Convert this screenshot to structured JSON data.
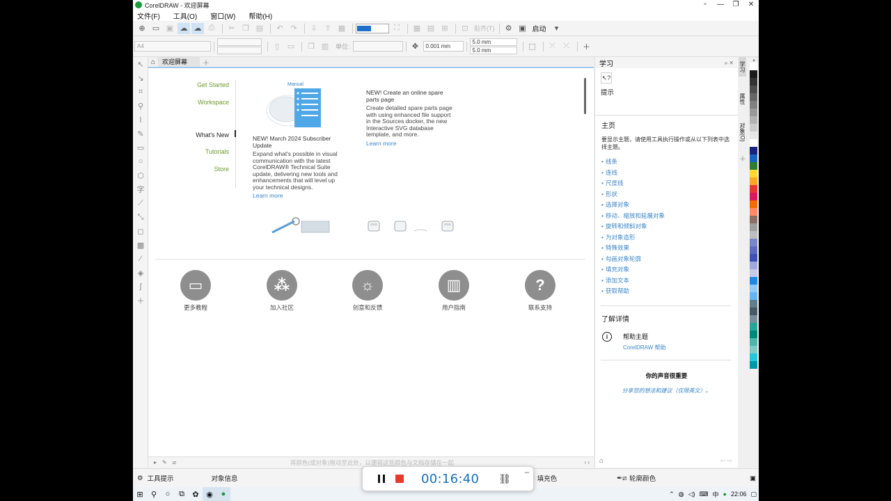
{
  "window": {
    "title": "CorelDRAW - 欢迎屏幕",
    "controls": [
      "▫",
      "—",
      "❐",
      "✕"
    ]
  },
  "menu": [
    "文件(F)",
    "工具(O)",
    "窗口(W)",
    "帮助(H)"
  ],
  "toolbar1": {
    "paste_label": "贴齐(T)",
    "launch_label": "启动",
    "accent_color": "#1e6fc9"
  },
  "toolbar2": {
    "page_size": "A4",
    "unit_label": "单位:",
    "nudge": "0.001 mm",
    "dup_x": "5.0 mm",
    "dup_y": "5.0 mm"
  },
  "tab": {
    "label": "欢迎屏幕"
  },
  "welcome_nav": [
    {
      "label": "Get Started",
      "style": "green"
    },
    {
      "label": "Workspace",
      "style": "green"
    },
    {
      "label": "What's New",
      "style": "dark"
    },
    {
      "label": "Tutorials",
      "style": "green"
    },
    {
      "label": "Store",
      "style": "green"
    }
  ],
  "manual_label": "Manual",
  "news": [
    {
      "title": "NEW! March 2024 Subscriber Update",
      "body": "Expand what's possible in visual communication with the latest CorelDRAW® Technical Suite update, delivering new tools and enhancements that will level up your technical designs.",
      "link": "Learn more"
    },
    {
      "title": "NEW! Create an online spare parts page",
      "body": "Create detailed spare parts page with using enhanced file support in the Sources docker, the new Interactive SVG database template, and more.",
      "link": "Learn more"
    }
  ],
  "quick_links": [
    {
      "label": "更多教程",
      "icon": "monitor-graduate-icon"
    },
    {
      "label": "加入社区",
      "icon": "community-icon"
    },
    {
      "label": "创意和反馈",
      "icon": "idea-head-icon"
    },
    {
      "label": "用户指南",
      "icon": "book-icon"
    },
    {
      "label": "联系支持",
      "icon": "question-icon"
    }
  ],
  "status_hint": "将颜色(或对象)拖动至此处，以便将这些颜色与文档存储在一起",
  "bottom": {
    "tool_hint": "工具提示",
    "object_info": "对象信息",
    "fill": "填充色",
    "outline": "轮廓颜色"
  },
  "docker": {
    "title": "学习",
    "hint_title": "提示",
    "home": "主页",
    "intro": "要显示主题，请使用工具执行操作或从以下列表中选择主题。",
    "topics": [
      "线条",
      "连线",
      "尺度线",
      "形状",
      "选择对象",
      "移动、缩放和延展对象",
      "旋转和倾斜对象",
      "为对象造形",
      "特殊效果",
      "勾画对象轮廓",
      "填充对象",
      "添加文本",
      "获取帮助"
    ],
    "learn_more": "了解详情",
    "help_topic": "帮助主题",
    "help_link": "CorelDRAW 帮助",
    "voice": "你的声音很重要",
    "voice_link": "分享您的想法和建议（仅限英文）。"
  },
  "docker_tabs": [
    "学习",
    "属性",
    "对象(O)"
  ],
  "palette": [
    "#ffffff",
    "#1a1a1a",
    "#333333",
    "#4d4d4d",
    "#666666",
    "#808080",
    "#999999",
    "#b3b3b3",
    "#cccccc",
    "#e6e6e6",
    "#ffffff",
    "#1a237e",
    "#1565c0",
    "#2e7d32",
    "#fdd835",
    "#f9a825",
    "#e53935",
    "#d81b60",
    "#ef6c00",
    "#ff8a65",
    "#8d6e63",
    "#9e9e9e",
    "#bdbdbd",
    "#7986cb",
    "#5c6bc0",
    "#3f51b5",
    "#9fa8da",
    "#c5cae9",
    "#1e88e5",
    "#90caf9",
    "#64b5f6",
    "#607d8b",
    "#455a64",
    "#78909c",
    "#26a69a",
    "#00897b",
    "#4db6ac",
    "#80cbc4",
    "#26c6da",
    "#0097a7"
  ],
  "recorder": {
    "time": "00:16:40"
  },
  "taskbar": {
    "ime": "中",
    "clock": "22:06"
  }
}
